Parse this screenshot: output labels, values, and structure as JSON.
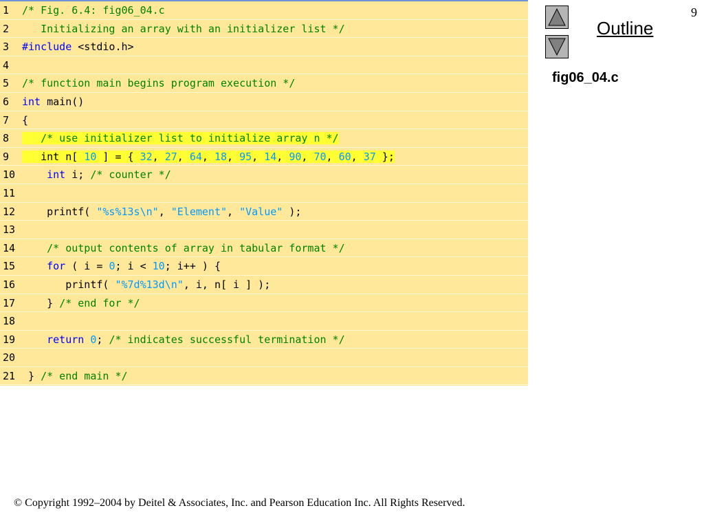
{
  "slide": {
    "number": "9",
    "outline_label": "Outline",
    "file_label": "fig06_04.c",
    "copyright": "© Copyright 1992–2004 by Deitel & Associates, Inc. and Pearson Education Inc. All Rights Reserved."
  },
  "colors": {
    "panel_bg": "#ffe89a",
    "highlight": "#ffff33",
    "comment": "#008000",
    "keyword": "#0000ff",
    "literal": "#0099ff"
  },
  "icons": {
    "up": "triangle-up-icon",
    "down": "triangle-down-icon"
  },
  "code_lines": [
    {
      "num": "1",
      "highlight": false,
      "segments": [
        {
          "t": "comment",
          "s": "/* Fig. 6.4: fig06_04.c"
        }
      ]
    },
    {
      "num": "2",
      "highlight": false,
      "segments": [
        {
          "t": "comment",
          "s": "   Initializing an array with an initializer list */"
        }
      ]
    },
    {
      "num": "3",
      "highlight": false,
      "segments": [
        {
          "t": "keyword",
          "s": "#include"
        },
        {
          "t": "plain",
          "s": " <stdio.h>"
        }
      ]
    },
    {
      "num": "4",
      "highlight": false,
      "segments": []
    },
    {
      "num": "5",
      "highlight": false,
      "segments": [
        {
          "t": "comment",
          "s": "/* function main begins program execution */"
        }
      ]
    },
    {
      "num": "6",
      "highlight": false,
      "segments": [
        {
          "t": "keyword",
          "s": "int"
        },
        {
          "t": "plain",
          "s": " main()"
        }
      ]
    },
    {
      "num": "7",
      "highlight": false,
      "segments": [
        {
          "t": "plain",
          "s": "{"
        }
      ]
    },
    {
      "num": "8",
      "highlight": true,
      "segments": [
        {
          "t": "comment",
          "s": "   /* use initializer list to initialize array n */"
        }
      ]
    },
    {
      "num": "9",
      "highlight": true,
      "segments": [
        {
          "t": "plain",
          "s": "   int n[ "
        },
        {
          "t": "number",
          "s": "10"
        },
        {
          "t": "plain",
          "s": " ] = { "
        },
        {
          "t": "number",
          "s": "32"
        },
        {
          "t": "plain",
          "s": ", "
        },
        {
          "t": "number",
          "s": "27"
        },
        {
          "t": "plain",
          "s": ", "
        },
        {
          "t": "number",
          "s": "64"
        },
        {
          "t": "plain",
          "s": ", "
        },
        {
          "t": "number",
          "s": "18"
        },
        {
          "t": "plain",
          "s": ", "
        },
        {
          "t": "number",
          "s": "95"
        },
        {
          "t": "plain",
          "s": ", "
        },
        {
          "t": "number",
          "s": "14"
        },
        {
          "t": "plain",
          "s": ", "
        },
        {
          "t": "number",
          "s": "90"
        },
        {
          "t": "plain",
          "s": ", "
        },
        {
          "t": "number",
          "s": "70"
        },
        {
          "t": "plain",
          "s": ", "
        },
        {
          "t": "number",
          "s": "60"
        },
        {
          "t": "plain",
          "s": ", "
        },
        {
          "t": "number",
          "s": "37"
        },
        {
          "t": "plain",
          "s": " };"
        }
      ]
    },
    {
      "num": "10",
      "highlight": false,
      "segments": [
        {
          "t": "plain",
          "s": "    "
        },
        {
          "t": "keyword",
          "s": "int"
        },
        {
          "t": "plain",
          "s": " i; "
        },
        {
          "t": "comment",
          "s": "/* counter */"
        }
      ]
    },
    {
      "num": "11",
      "highlight": false,
      "segments": []
    },
    {
      "num": "12",
      "highlight": false,
      "segments": [
        {
          "t": "plain",
          "s": "    printf( "
        },
        {
          "t": "string",
          "s": "\"%s%13s\\n\""
        },
        {
          "t": "plain",
          "s": ", "
        },
        {
          "t": "string",
          "s": "\"Element\""
        },
        {
          "t": "plain",
          "s": ", "
        },
        {
          "t": "string",
          "s": "\"Value\""
        },
        {
          "t": "plain",
          "s": " );"
        }
      ]
    },
    {
      "num": "13",
      "highlight": false,
      "segments": []
    },
    {
      "num": "14",
      "highlight": false,
      "segments": [
        {
          "t": "plain",
          "s": "    "
        },
        {
          "t": "comment",
          "s": "/* output contents of array in tabular format */"
        }
      ]
    },
    {
      "num": "15",
      "highlight": false,
      "segments": [
        {
          "t": "plain",
          "s": "    "
        },
        {
          "t": "keyword",
          "s": "for"
        },
        {
          "t": "plain",
          "s": " ( i = "
        },
        {
          "t": "number",
          "s": "0"
        },
        {
          "t": "plain",
          "s": "; i < "
        },
        {
          "t": "number",
          "s": "10"
        },
        {
          "t": "plain",
          "s": "; i++ ) {"
        }
      ]
    },
    {
      "num": "16",
      "highlight": false,
      "segments": [
        {
          "t": "plain",
          "s": "       printf( "
        },
        {
          "t": "string",
          "s": "\"%7d%13d\\n\""
        },
        {
          "t": "plain",
          "s": ", i, n[ i ] );"
        }
      ]
    },
    {
      "num": "17",
      "highlight": false,
      "segments": [
        {
          "t": "plain",
          "s": "    } "
        },
        {
          "t": "comment",
          "s": "/* end for */"
        }
      ]
    },
    {
      "num": "18",
      "highlight": false,
      "segments": []
    },
    {
      "num": "19",
      "highlight": false,
      "segments": [
        {
          "t": "plain",
          "s": "    "
        },
        {
          "t": "keyword",
          "s": "return"
        },
        {
          "t": "plain",
          "s": " "
        },
        {
          "t": "number",
          "s": "0"
        },
        {
          "t": "plain",
          "s": "; "
        },
        {
          "t": "comment",
          "s": "/* indicates successful termination */"
        }
      ]
    },
    {
      "num": "20",
      "highlight": false,
      "segments": []
    },
    {
      "num": "21",
      "highlight": false,
      "segments": [
        {
          "t": "plain",
          "s": " } "
        },
        {
          "t": "comment",
          "s": "/* end main */"
        }
      ]
    }
  ]
}
